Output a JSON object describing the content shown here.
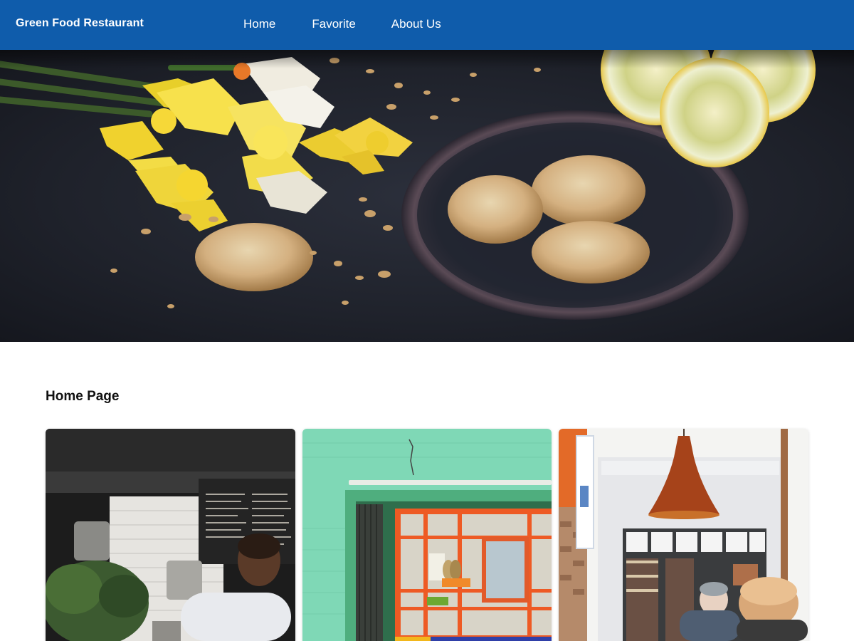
{
  "navbar": {
    "brand": "Green Food Restaurant",
    "links": [
      {
        "label": "Home"
      },
      {
        "label": "Favorite"
      },
      {
        "label": "About Us"
      }
    ],
    "background_color": "#0f5cab"
  },
  "hero": {
    "image": "food-flatlay-cookies-daffodils-lemons"
  },
  "main": {
    "section_title": "Home Page",
    "cards": [
      {
        "image": "restaurant-kitchen-chef-chalkboard-menu"
      },
      {
        "image": "green-storefront-orange-window"
      },
      {
        "image": "street-cafe-orange-pendant-lamp"
      }
    ]
  }
}
